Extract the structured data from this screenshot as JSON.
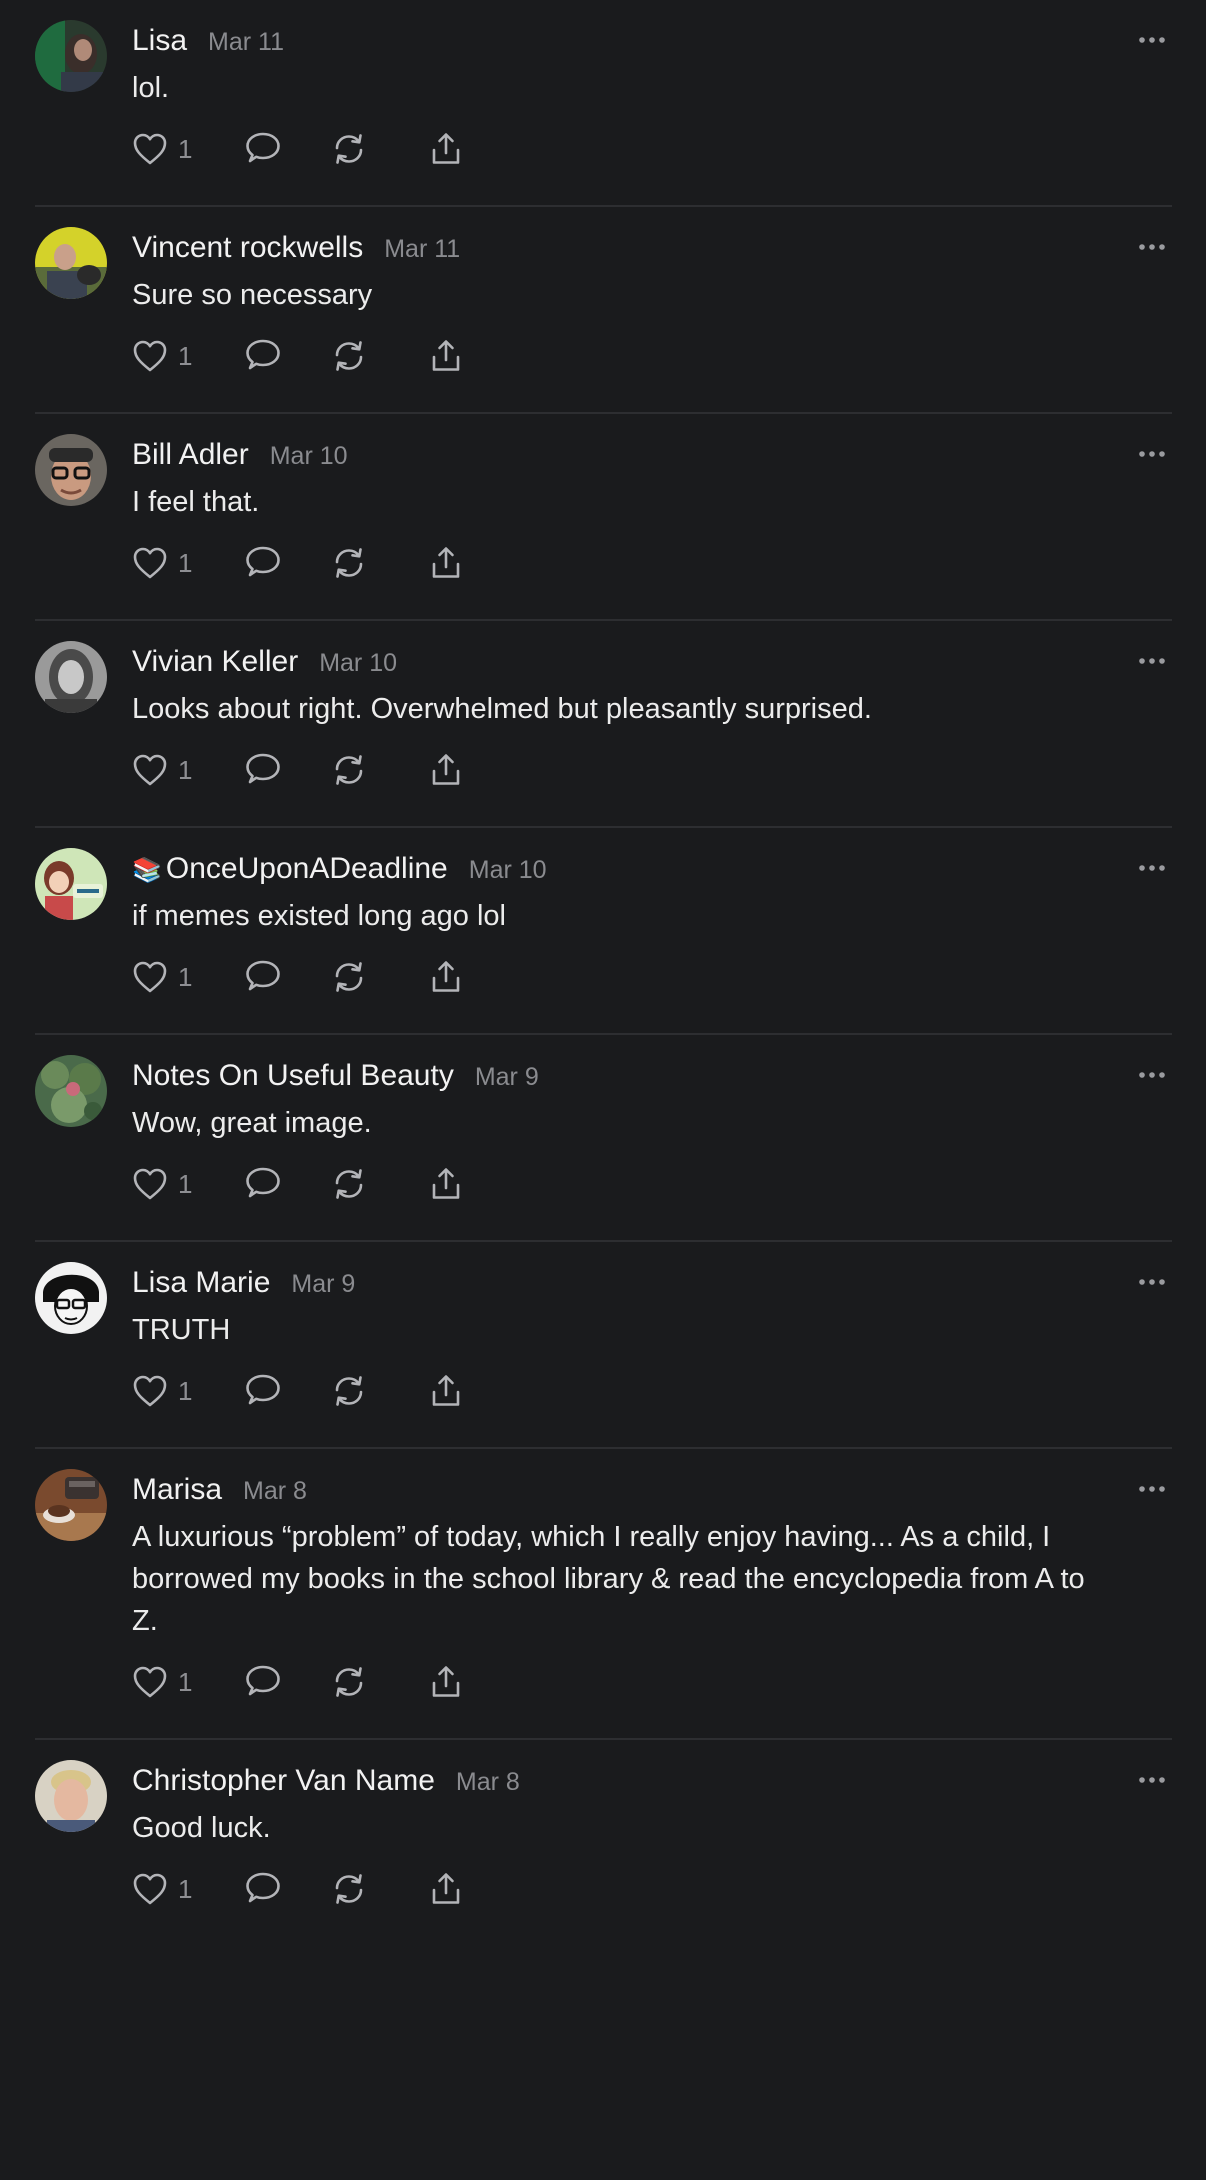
{
  "comments": [
    {
      "author": "Lisa",
      "date": "Mar 11",
      "text": "lol.",
      "likes": "1",
      "avatar": "avatar-dark"
    },
    {
      "author": "Vincent rockwells",
      "date": "Mar 11",
      "text": "Sure so necessary",
      "likes": "1",
      "avatar": "avatar-yellow"
    },
    {
      "author": "Bill Adler",
      "date": "Mar 10",
      "text": "I feel that.",
      "likes": "1",
      "avatar": "avatar-glasses"
    },
    {
      "author": "Vivian Keller",
      "date": "Mar 10",
      "text": "Looks about right. Overwhelmed but pleasantly surprised.",
      "likes": "1",
      "avatar": "avatar-gray"
    },
    {
      "author": "OnceUponADeadline",
      "author_prefix": "📚",
      "date": "Mar 10",
      "text": "if memes existed long ago lol",
      "likes": "1",
      "avatar": "avatar-cartoon"
    },
    {
      "author": "Notes On Useful Beauty",
      "date": "Mar 9",
      "text": "Wow, great image.",
      "likes": "1",
      "avatar": "avatar-green"
    },
    {
      "author": "Lisa Marie",
      "date": "Mar 9",
      "text": "TRUTH",
      "likes": "1",
      "avatar": "avatar-sketch"
    },
    {
      "author": "Marisa",
      "date": "Mar 8",
      "text": "A luxurious “problem” of today, which I really enjoy having... As a child, I borrowed my books in the school library & read the encyclopedia from A to Z.",
      "likes": "1",
      "avatar": "avatar-coffee"
    },
    {
      "author": "Christopher Van Name",
      "date": "Mar 8",
      "text": "Good luck.",
      "likes": "1",
      "avatar": "avatar-blond"
    }
  ],
  "icons": {
    "like": "heart-icon",
    "reply": "speech-bubble-icon",
    "repost": "repost-icon",
    "share": "share-icon",
    "more": "more-dots-icon"
  },
  "colors": {
    "background": "#1a1b1d",
    "divider": "#2d2e31",
    "text": "#ececec",
    "muted": "#8a8b8f"
  }
}
